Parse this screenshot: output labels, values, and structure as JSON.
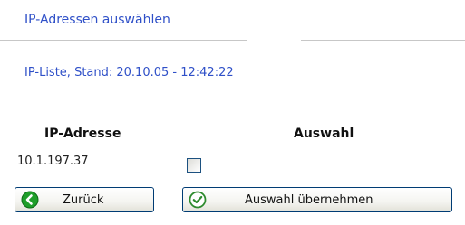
{
  "header": {
    "title": "IP-Adressen auswählen",
    "subtitle": "IP-Liste, Stand: 20.10.05 - 12:42:22"
  },
  "table": {
    "columns": [
      "IP-Adresse",
      "Auswahl"
    ],
    "rows": [
      {
        "ip": "10.1.197.37",
        "selected": false
      }
    ]
  },
  "buttons": {
    "back_label": "Zurück",
    "apply_label": "Auswahl übernehmen"
  },
  "colors": {
    "accent_blue": "#2f50c8",
    "back_icon_green": "#1f9e2a",
    "check_icon_green": "#2e8b2e"
  },
  "icons": {
    "back": "arrow-left-circle-icon",
    "apply": "checkmark-circle-icon"
  }
}
